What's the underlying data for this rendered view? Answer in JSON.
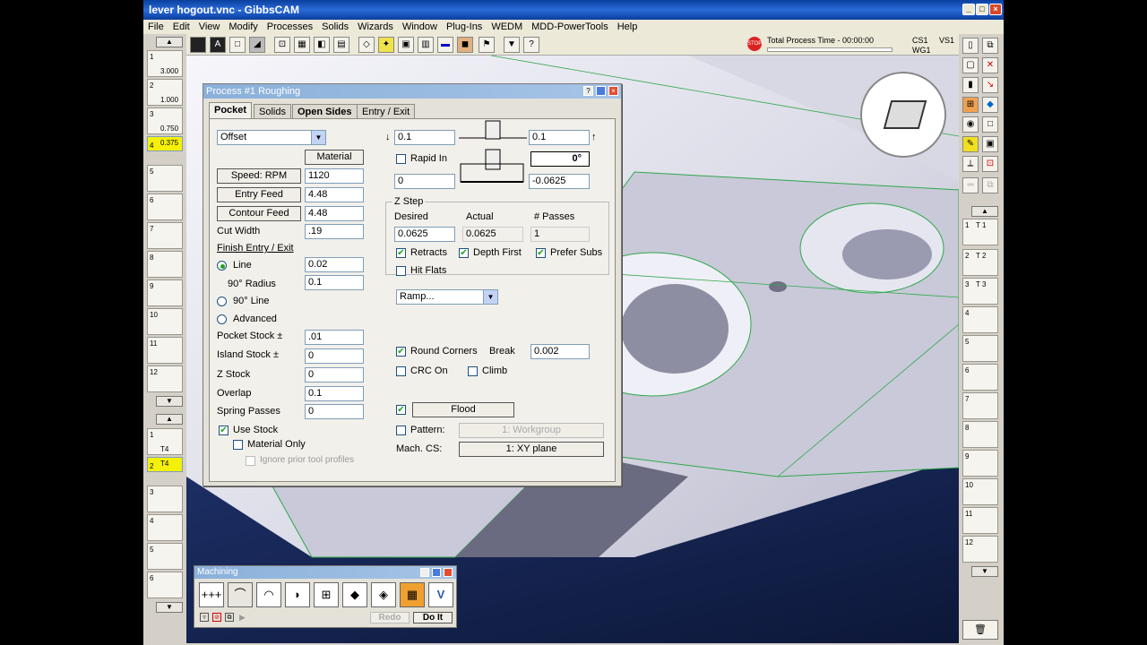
{
  "window": {
    "title": "lever hogout.vnc - GibbsCAM",
    "min": "_",
    "max": "□",
    "close": "×"
  },
  "menu": [
    "File",
    "Edit",
    "View",
    "Modify",
    "Processes",
    "Solids",
    "Wizards",
    "Window",
    "Plug-Ins",
    "WEDM",
    "MDD-PowerTools",
    "Help"
  ],
  "status": {
    "label": "Total Process Time - 00:00:00",
    "cs": "CS1",
    "wg": "WG1",
    "vs": "VS1",
    "stop": "STOP"
  },
  "tools_left": [
    {
      "num": "1",
      "cap": "3.000"
    },
    {
      "num": "2",
      "cap": "1.000"
    },
    {
      "num": "3",
      "cap": "0.750"
    },
    {
      "num": "4",
      "cap": "0.375"
    }
  ],
  "tool_slot_numbers": [
    "5",
    "6",
    "7",
    "8",
    "9",
    "10",
    "11",
    "12"
  ],
  "process_slots": [
    {
      "num": "1",
      "tag": "T4"
    },
    {
      "num": "2",
      "tag": "T4"
    }
  ],
  "process_slot_numbers": [
    "3",
    "4",
    "5",
    "6"
  ],
  "right_tools": [
    {
      "num": "1",
      "tag": "T 1"
    },
    {
      "num": "2",
      "tag": "T 2"
    },
    {
      "num": "3",
      "tag": "T 3"
    }
  ],
  "right_slot_numbers": [
    "4",
    "5",
    "6",
    "7",
    "8",
    "9",
    "10",
    "11",
    "12"
  ],
  "dialog": {
    "title": "Process #1 Roughing",
    "tabs": [
      "Pocket",
      "Solids",
      "Open Sides",
      "Entry / Exit"
    ],
    "strategy": "Offset",
    "material_btn": "Material",
    "speed_btn": "Speed: RPM",
    "speed": "1120",
    "entry_btn": "Entry Feed",
    "entry": "4.48",
    "contour_btn": "Contour Feed",
    "contour": "4.48",
    "cut_width_lbl": "Cut Width",
    "cut_width": ".19",
    "finish_lbl": "Finish Entry / Exit",
    "line_lbl": "Line",
    "line_val": "0.02",
    "radius_lbl": "90° Radius",
    "radius_val": "0.1",
    "line90_lbl": "90° Line",
    "advanced_lbl": "Advanced",
    "pocket_stock_lbl": "Pocket Stock ±",
    "pocket_stock": ".01",
    "island_stock_lbl": "Island Stock ±",
    "island_stock": "0",
    "z_stock_lbl": "Z Stock",
    "z_stock": "0",
    "overlap_lbl": "Overlap",
    "overlap": "0.1",
    "spring_lbl": "Spring Passes",
    "spring": "0",
    "use_stock_lbl": "Use Stock",
    "material_only_lbl": "Material Only",
    "ignore_lbl": "Ignore prior tool profiles",
    "clear_top": "0.1",
    "clear_right": "0.1",
    "rapid_in_lbl": "Rapid In",
    "angle": "0°",
    "z_top": "0",
    "z_bottom": "-0.0625",
    "zstep_lbl": "Z Step",
    "desired_lbl": "Desired",
    "actual_lbl": "Actual",
    "passes_lbl": "# Passes",
    "desired": "0.0625",
    "actual": "0.0625",
    "passes": "1",
    "retracts_lbl": "Retracts",
    "depth_first_lbl": "Depth First",
    "prefer_subs_lbl": "Prefer Subs",
    "hit_flats_lbl": "Hit Flats",
    "ramp": "Ramp...",
    "round_corners_lbl": "Round Corners",
    "break_lbl": "Break",
    "break_val": "0.002",
    "crc_lbl": "CRC On",
    "climb_lbl": "Climb",
    "flood": "Flood",
    "pattern_lbl": "Pattern:",
    "pattern": "1: Workgroup",
    "mach_cs_lbl": "Mach. CS:",
    "mach_cs": "1: XY plane"
  },
  "machining": {
    "title": "Machining",
    "redo": "Redo",
    "doit": "Do It",
    "buttons": [
      "+++",
      "⌒",
      "◠",
      "◗",
      "⊞",
      "◆",
      "◈",
      "▦",
      "V"
    ]
  }
}
